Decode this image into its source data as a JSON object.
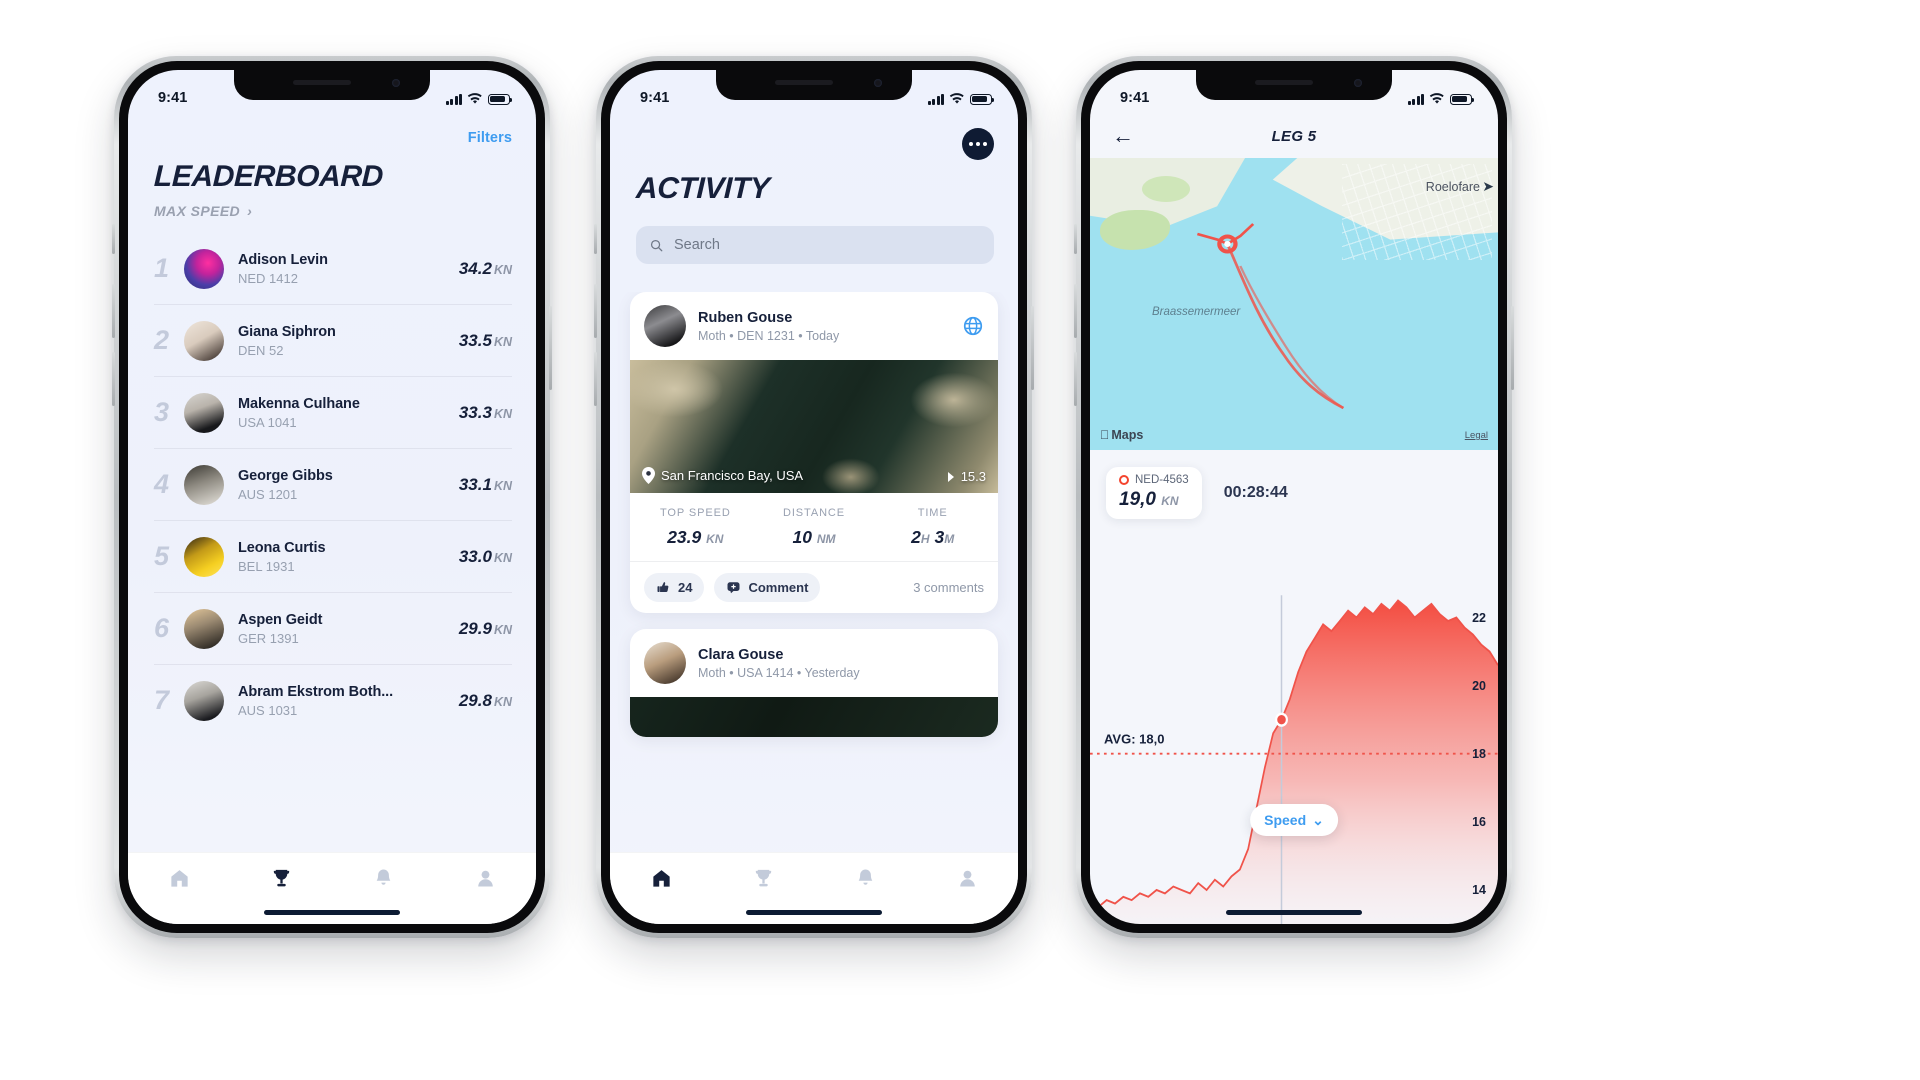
{
  "status_bar": {
    "time": "9:41"
  },
  "phone1": {
    "name": "leaderboard-screen",
    "filters_label": "Filters",
    "title": "LEADERBOARD",
    "sort_label": "MAX SPEED",
    "sort_chevron": "chevron-right-icon",
    "unit": "KN",
    "rows": [
      {
        "rank": "1",
        "name": "Adison Levin",
        "sail": "NED 1412",
        "value": "34.2"
      },
      {
        "rank": "2",
        "name": "Giana Siphron",
        "sail": "DEN 52",
        "value": "33.5"
      },
      {
        "rank": "3",
        "name": "Makenna Culhane",
        "sail": "USA 1041",
        "value": "33.3"
      },
      {
        "rank": "4",
        "name": "George Gibbs",
        "sail": "AUS 1201",
        "value": "33.1"
      },
      {
        "rank": "5",
        "name": "Leona Curtis",
        "sail": "BEL 1931",
        "value": "33.0"
      },
      {
        "rank": "6",
        "name": "Aspen Geidt",
        "sail": "GER 1391",
        "value": "29.9"
      },
      {
        "rank": "7",
        "name": "Abram Ekstrom Both...",
        "sail": "AUS 1031",
        "value": "29.8"
      }
    ],
    "tabs": [
      {
        "icon": "home-icon",
        "active": false
      },
      {
        "icon": "trophy-icon",
        "active": true
      },
      {
        "icon": "bell-icon",
        "active": false
      },
      {
        "icon": "profile-icon",
        "active": false
      }
    ]
  },
  "phone2": {
    "name": "activity-screen",
    "title": "ACTIVITY",
    "more_icon": "more-dots-icon",
    "search": {
      "placeholder": "Search",
      "icon": "search-icon"
    },
    "posts": [
      {
        "author": "Ruben Gouse",
        "meta": "Moth • DEN 1231 • Today",
        "visibility_icon": "globe-icon",
        "map": {
          "location": "San Francisco Bay, USA",
          "location_icon": "map-pin-icon",
          "speed": "15.3",
          "speed_icon": "speed-arrow-icon"
        },
        "stats": [
          {
            "label": "TOP SPEED",
            "value": "23.9",
            "unit": "KN"
          },
          {
            "label": "DISTANCE",
            "value": "10",
            "unit": "NM"
          },
          {
            "label": "TIME",
            "value": "2",
            "unit": "H",
            "value2": "3",
            "unit2": "M"
          }
        ],
        "likes": "24",
        "like_icon": "thumbs-up-icon",
        "comment_label": "Comment",
        "comment_icon": "comment-icon",
        "comments_count": "3 comments"
      },
      {
        "author": "Clara Gouse",
        "meta": "Moth  • USA 1414 •  Yesterday",
        "visibility_icon": "globe-icon"
      }
    ],
    "tabs": [
      {
        "icon": "home-icon",
        "active": true
      },
      {
        "icon": "trophy-icon",
        "active": false
      },
      {
        "icon": "bell-icon",
        "active": false
      },
      {
        "icon": "profile-icon",
        "active": false
      }
    ]
  },
  "phone3": {
    "name": "leg-detail-screen",
    "back_icon": "back-arrow-icon",
    "title": "LEG 5",
    "map": {
      "label_place": "Roelofare",
      "label_water": "Braassemermeer",
      "attribution": "Maps",
      "attribution_icon": "apple-logo-icon",
      "legal": "Legal",
      "compass_icon": "north-arrow-icon",
      "track_color": "#f0534a"
    },
    "boat": {
      "sail": "NED-4563",
      "marker_icon": "boat-marker-icon",
      "speed": "19,0",
      "unit": "KN",
      "elapsed": "00:28:44"
    },
    "chart_toggle": {
      "label": "Speed",
      "icon": "chevron-down-icon"
    },
    "avg_label": "AVG: 18,0"
  },
  "chart_data": {
    "type": "area",
    "title": "Speed",
    "ylabel": "KN",
    "yticks": [
      22,
      20,
      18,
      16,
      14
    ],
    "ylim": [
      13,
      23
    ],
    "avg": 18.0,
    "avg_label": "AVG: 18,0",
    "cursor_value": 19.0,
    "series": [
      {
        "name": "Speed",
        "color": "#f0534a",
        "values": [
          13.6,
          13.5,
          13.7,
          13.6,
          13.8,
          13.7,
          13.9,
          13.8,
          14.0,
          13.9,
          14.1,
          14.0,
          13.9,
          14.2,
          14.0,
          14.3,
          14.1,
          14.4,
          14.6,
          15.2,
          16.4,
          17.6,
          18.6,
          19.0,
          19.6,
          20.4,
          21.0,
          21.4,
          21.8,
          21.6,
          21.9,
          22.2,
          22.0,
          22.3,
          22.1,
          22.4,
          22.2,
          22.5,
          22.3,
          22.0,
          22.2,
          22.4,
          22.1,
          21.9,
          22.0,
          21.7,
          21.5,
          21.2,
          21.0,
          20.6
        ]
      }
    ]
  }
}
